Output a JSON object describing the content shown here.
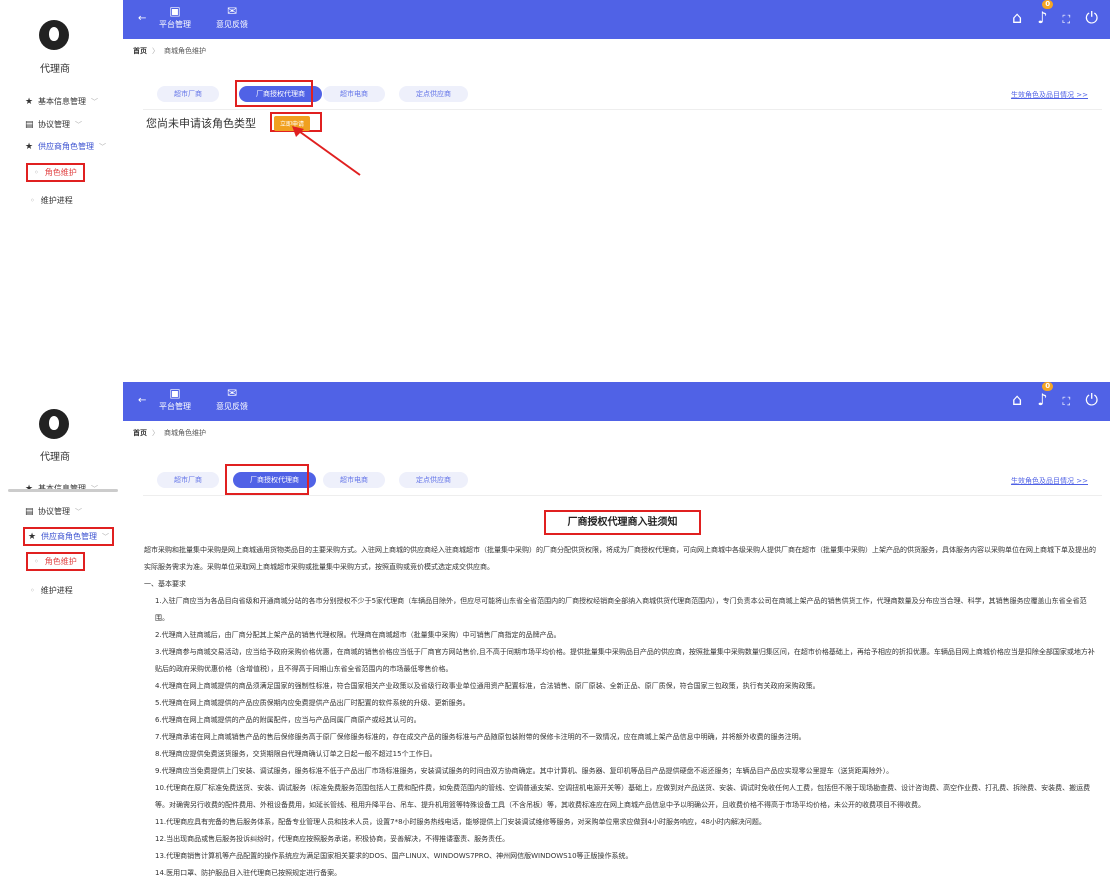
{
  "sidebar": {
    "label": "代理商",
    "items": [
      {
        "icon": "star-icon",
        "label": "基本信息管理",
        "has_chevron": true
      },
      {
        "icon": "document-icon",
        "label": "协议管理",
        "has_chevron": true
      },
      {
        "icon": "star-icon",
        "label": "供应商角色管理",
        "has_chevron": true
      }
    ],
    "subitems": [
      {
        "label": "角色维护",
        "active": true
      },
      {
        "label": "维护进程",
        "active": false
      }
    ]
  },
  "topbar": {
    "back": "←",
    "buttons": [
      {
        "icon": "platform-icon",
        "label": "平台管理"
      },
      {
        "icon": "feedback-icon",
        "label": "意见反馈"
      }
    ],
    "right_icons": [
      "home-icon",
      "bell-icon",
      "fullscreen-icon",
      "power-icon"
    ],
    "notification_count": "0"
  },
  "breadcrumb": {
    "home": "首页",
    "current": "商城角色维护"
  },
  "tabs": [
    "超市厂商",
    "厂商授权代理商",
    "超市电商",
    "定点供应商"
  ],
  "active_tab": 1,
  "tabs_link": "生效角色及品目情况 >>",
  "notice": {
    "message": "您尚未申请该角色类型",
    "apply_button": "立即申请"
  },
  "document": {
    "title": "厂商授权代理商入驻须知",
    "intro": "超市采购和批量集中采购是网上商城通用货物类品目的主要采购方式。入驻网上商城的供应商经入驻商城超市（批量集中采购）的厂商分配供货权限，将成为厂商授权代理商，可向网上商城中各级采购人提供厂商在超市（批量集中采购）上架产品的供货服务，具体服务内容以采购单位在网上商城下单及提出的实际服务需求为准。采购单位采取网上商城超市采购或批量集中采购方式，按照直购或竞价模式选定成交供应商。",
    "section": "一、基本要求",
    "items": [
      "1.入驻厂商应当为各品目向省级和开通商城分站的各市分别授权不少于5家代理商（车辆品目除外，但应尽可能将山东省全省范围内的厂商授权经销商全部纳入商城供货代理商范围内），专门负责本公司在商城上架产品的销售供货工作，代理商数量及分布应当合理、科学，其销售服务应覆盖山东省全省范围。",
      "2.代理商入驻商城后，由厂商分配其上架产品的销售代理权限。代理商在商城超市（批量集中采购）中可销售厂商指定的品牌产品。",
      "3.代理商参与商城交易活动，应当给予政府采购价格优惠，在商城的销售价格应当低于厂商官方网站售价,且不高于同期市场平均价格。提供批量集中采购品目产品的供应商，按照批量集中采购数量归集区间，在超市价格基础上，再给予相应的折扣优惠。车辆品目网上商城价格应当是扣除全部国家或地方补贴后的政府采购优惠价格（含增值税），且不得高于同期山东省全省范围内的市场最低零售价格。",
      "4.代理商在网上商城提供的商品须满足国家的强制性标准，符合国家相关产业政策以及省级行政事业单位通用资产配置标准，合法销售、原厂原装、全新正品、原厂质保，符合国家三包政策，执行有关政府采购政策。",
      "5.代理商在网上商城提供的产品应质保期内应免费提供产品出厂时配置的软件系统的升级、更新服务。",
      "6.代理商在网上商城提供的产品的附属配件，应当与产品同属厂商原产或经其认可的。",
      "7.代理商承诺在网上商城销售产品的售后保修服务高于原厂保修服务标准的，存在成交产品的服务标准与产品随原包装附带的保修卡注明的不一致情况，应在商城上架产品信息中明确，并将额外收费的服务注明。",
      "8.代理商应提供免费送货服务，交货期限自代理商确认订单之日起一般不超过15个工作日。",
      "9.代理商应当免费提供上门安装、调试服务，服务标准不低于产品出厂市场标准服务，安装调试服务的时间由双方协商确定。其中计算机、服务器、复印机等品目产品提供硬盘不返还服务；车辆品目产品应实现零公里提车（送货距离除外）。",
      "10.代理商在原厂标准免费送货、安装、调试服务（标准免费服务范围包括人工费和配件费，如免费范围内的管线、空调普通支架、空调扭机电源开关等）基础上，应做到对产品送货、安装、调试时免收任何人工费，包括但不限于现场勘查费、设计咨询费、高空作业费、打孔费、拆除费、安装费、搬运费等。对确需另行收费的配件费用、外租设备费用，如延长管线、租用升降平台、吊车、提升机用篮等特殊设备工具（不含吊板）等，其收费标准应在网上商城产品信息中予以明确公开，且收费价格不得高于市场平均价格，未公开的收费项目不得收费。",
      "11.代理商应具有完备的售后服务体系，配备专业管理人员和技术人员，设置7*8小时服务热线电话，能够提供上门安装调试维修等服务，对采购单位需求应做到4小时服务响应，48小时内解决问题。",
      "12.当出现商品或售后服务投诉纠纷时，代理商应按照服务承诺，积极协商，妥善解决，不得推诿塞责、服务责任。",
      "13.代理商销售计算机等产品配置的操作系统应为满足国家相关要求的DOS、国产LINUX、WINDOWS7PRO、神州网信版WINDOWS10等正版操作系统。",
      "14.医用口罩、防护服品目入驻代理商已按照规定进行备案。"
    ]
  }
}
